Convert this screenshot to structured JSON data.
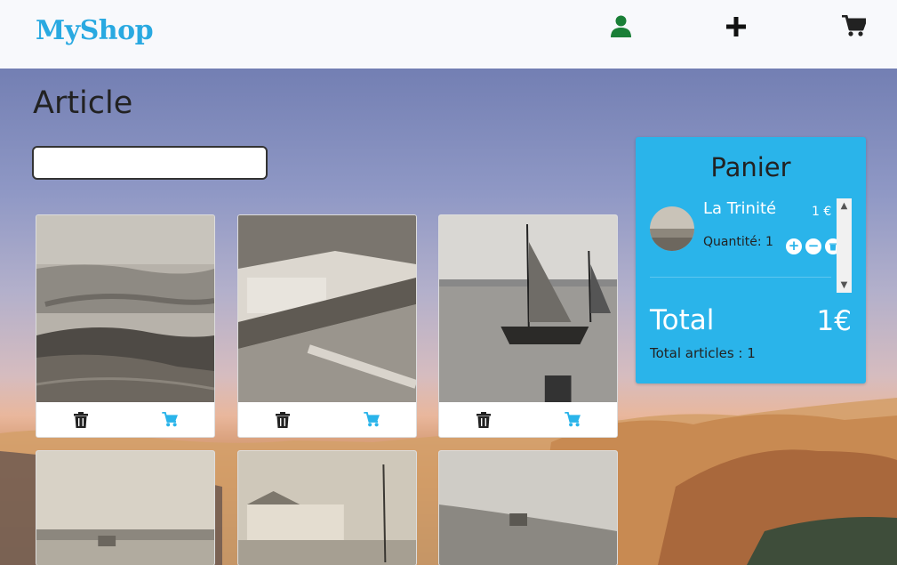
{
  "nav": {
    "logo": "MyShop",
    "icons": [
      "user-icon",
      "plus-icon",
      "cart-icon"
    ],
    "colors": {
      "logo": "#29a9e1",
      "user_icon": "#1a7f37",
      "background": "#f8f9fc"
    }
  },
  "main": {
    "title": "Article",
    "search": {
      "value": "",
      "placeholder": ""
    }
  },
  "products": [
    {
      "actions": [
        "trash-icon",
        "cart-icon"
      ]
    },
    {
      "actions": [
        "trash-icon",
        "cart-icon"
      ]
    },
    {
      "actions": [
        "trash-icon",
        "cart-icon"
      ]
    },
    {
      "actions": []
    },
    {
      "actions": []
    },
    {
      "actions": []
    }
  ],
  "cart": {
    "title": "Panier",
    "items": [
      {
        "name": "La Trinité",
        "price": "1 €",
        "quantity_label": "Quantité: 1"
      }
    ],
    "total_label": "Total",
    "total_value": "1€",
    "total_count": "Total articles : 1",
    "colors": {
      "panel": "#2ab4ea",
      "accent_icon": "#2ab4ea"
    }
  }
}
